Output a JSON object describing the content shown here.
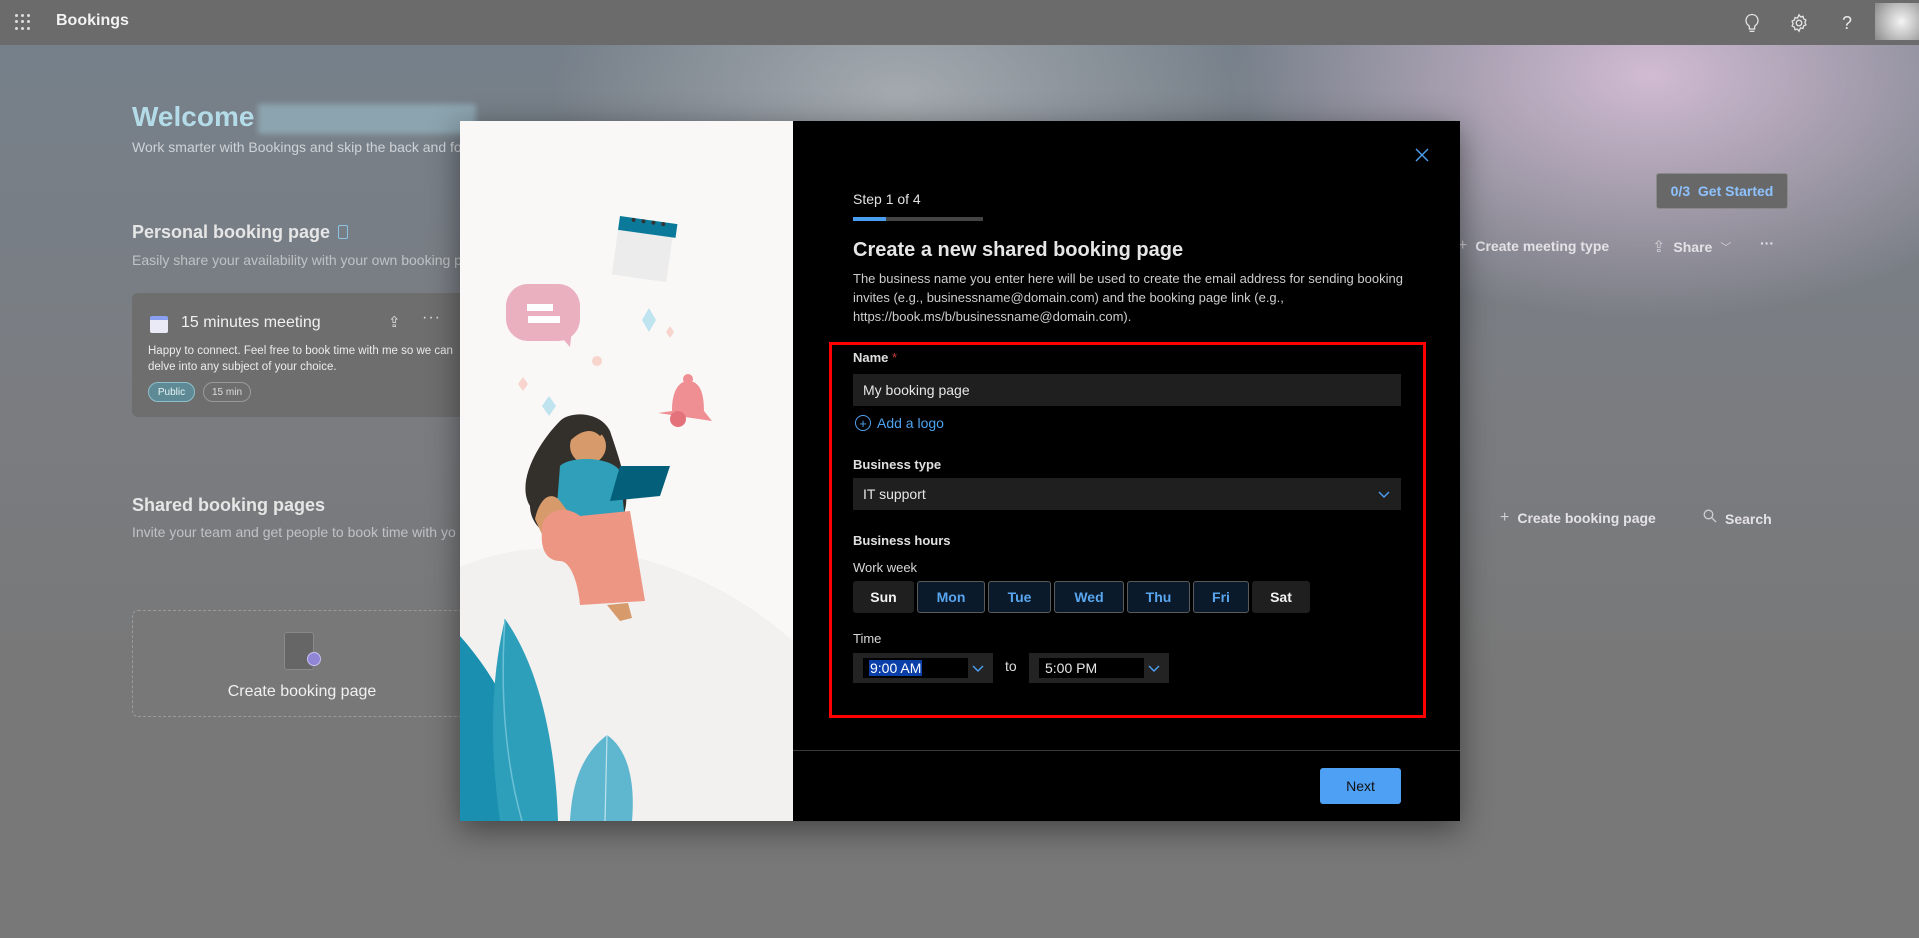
{
  "app": {
    "title": "Bookings",
    "top_icons": [
      "lightbulb-icon",
      "gear-icon",
      "help-icon"
    ]
  },
  "background": {
    "welcome": "Welcome",
    "welcome_sub": "Work smarter with Bookings and skip the back and fo",
    "get_started": {
      "count": "0/3",
      "label": "Get Started"
    },
    "personal": {
      "title": "Personal booking page",
      "subtitle": "Easily share your availability with your own booking p",
      "actions": {
        "create_meeting_type": "Create meeting type",
        "share": "Share",
        "more": "···"
      },
      "card": {
        "title": "15 minutes meeting",
        "description": "Happy to connect. Feel free to book time with me so we can delve into any subject of your choice.",
        "badges": [
          "Public",
          "15 min"
        ]
      }
    },
    "shared": {
      "title": "Shared booking pages",
      "subtitle": "Invite your team and get people to book time with yo",
      "actions": {
        "create_booking_page": "Create booking page",
        "search": "Search"
      },
      "create_card_label": "Create booking page"
    }
  },
  "modal": {
    "step_label": "Step 1 of 4",
    "progress_fraction": 0.25,
    "title": "Create a new shared booking page",
    "description": "The business name you enter here will be used to create the email address for sending booking invites (e.g., businessname@domain.com) and the booking page link (e.g., https://book.ms/b/businessname@domain.com).",
    "name_label": "Name",
    "required_mark": "*",
    "name_value": "My booking page",
    "add_logo": "Add a logo",
    "business_type_label": "Business type",
    "business_type_value": "IT support",
    "business_hours_label": "Business hours",
    "work_week_label": "Work week",
    "days": [
      {
        "label": "Sun",
        "selected": false
      },
      {
        "label": "Mon",
        "selected": true
      },
      {
        "label": "Tue",
        "selected": true
      },
      {
        "label": "Wed",
        "selected": true
      },
      {
        "label": "Thu",
        "selected": true
      },
      {
        "label": "Fri",
        "selected": true
      },
      {
        "label": "Sat",
        "selected": false
      }
    ],
    "time_label": "Time",
    "start_time": "9:00 AM",
    "to_label": "to",
    "end_time": "5:00 PM",
    "next_button": "Next"
  },
  "colors": {
    "accent": "#4ea0f5",
    "highlight_box": "#ff0000",
    "modal_bg": "#000000"
  }
}
